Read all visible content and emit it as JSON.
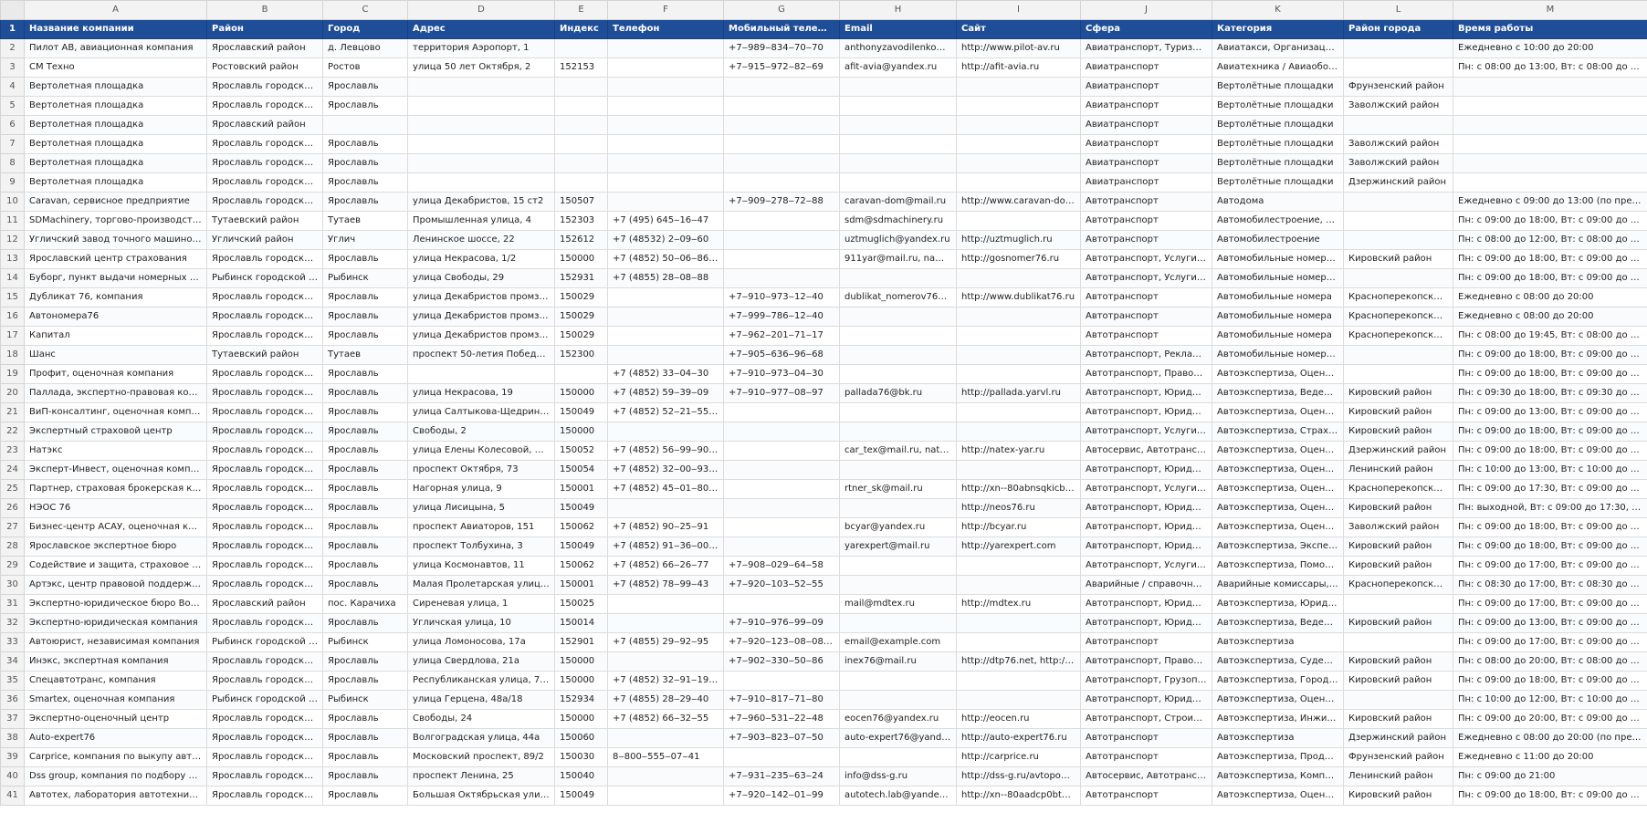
{
  "columns": [
    "A",
    "B",
    "C",
    "D",
    "E",
    "F",
    "G",
    "H",
    "I",
    "J",
    "K",
    "L",
    "M"
  ],
  "header": {
    "row_num": "1",
    "cells": [
      "Название компании",
      "Район",
      "Город",
      "Адрес",
      "Индекс",
      "Телефон",
      "Мобильный телефон",
      "Email",
      "Сайт",
      "Сфера",
      "Категория",
      "Район города",
      "Время работы"
    ]
  },
  "rows": [
    {
      "n": "2",
      "c": [
        "Пилот АВ, авиационная компания",
        "Ярославский район",
        "д. Левцово",
        "территория Аэропорт, 1",
        "",
        "",
        "+7‒989‒834‒70‒70",
        "anthonyzavodilenko@y...",
        "http://www.pilot-av.ru",
        "Авиатранспорт, Туризм / ...",
        "Авиатакси, Организация а...",
        "",
        "Ежедневно с 10:00 до 20:00"
      ]
    },
    {
      "n": "3",
      "c": [
        "СМ Техно",
        "Ростовский район",
        "Ростов",
        "улица 50 лет Октября, 2",
        "152153",
        "",
        "+7‒915‒972‒82‒69",
        "afit-avia@yandex.ru",
        "http://afit-avia.ru",
        "Авиатранспорт",
        "Авиатехника / Авиаобору...",
        "",
        "Пн: с 08:00 до 13:00, Вт: с 08:00 до 13:00, С..."
      ]
    },
    {
      "n": "4",
      "c": [
        "Вертолетная площадка",
        "Ярославль городской ...",
        "Ярославль",
        "",
        "",
        "",
        "",
        "",
        "",
        "Авиатранспорт",
        "Вертолётные площадки",
        "Фрунзенский район",
        ""
      ]
    },
    {
      "n": "5",
      "c": [
        "Вертолетная площадка",
        "Ярославль городской ...",
        "Ярославль",
        "",
        "",
        "",
        "",
        "",
        "",
        "Авиатранспорт",
        "Вертолётные площадки",
        "Заволжский район",
        ""
      ]
    },
    {
      "n": "6",
      "c": [
        "Вертолетная площадка",
        "Ярославский район",
        "",
        "",
        "",
        "",
        "",
        "",
        "",
        "Авиатранспорт",
        "Вертолётные площадки",
        "",
        ""
      ]
    },
    {
      "n": "7",
      "c": [
        "Вертолетная площадка",
        "Ярославль городской ...",
        "Ярославль",
        "",
        "",
        "",
        "",
        "",
        "",
        "Авиатранспорт",
        "Вертолётные площадки",
        "Заволжский район",
        ""
      ]
    },
    {
      "n": "8",
      "c": [
        "Вертолетная площадка",
        "Ярославль городской ...",
        "Ярославль",
        "",
        "",
        "",
        "",
        "",
        "",
        "Авиатранспорт",
        "Вертолётные площадки",
        "Заволжский район",
        ""
      ]
    },
    {
      "n": "9",
      "c": [
        "Вертолетная площадка",
        "Ярославль городской ...",
        "Ярославль",
        "",
        "",
        "",
        "",
        "",
        "",
        "Авиатранспорт",
        "Вертолётные площадки",
        "Дзержинский район",
        ""
      ]
    },
    {
      "n": "10",
      "c": [
        "Caravan, сервисное предприятие",
        "Ярославль городской ...",
        "Ярославль",
        "улица Декабристов, 15 ст2",
        "150507",
        "",
        "+7‒909‒278‒72‒88",
        "caravan-dom@mail.ru",
        "http://www.caravan-dom.ru",
        "Автотранспорт",
        "Автодома",
        "",
        "Ежедневно с 09:00 до 13:00 (по предвари..."
      ]
    },
    {
      "n": "11",
      "c": [
        "SDMachinery, торгово-производствен...",
        "Тутаевский район",
        "Тутаев",
        "Промышленная улица, 4",
        "152303",
        "+7 (495) 645‒16‒47",
        "",
        "sdm@sdmachinery.ru",
        "",
        "Автотранспорт",
        "Автомобилестроение, Спе...",
        "",
        "Пн: с 09:00 до 18:00, Вт: с 09:00 до 18:00, С..."
      ]
    },
    {
      "n": "12",
      "c": [
        "Угличский завод точного машиностр...",
        "Угличский район",
        "Углич",
        "Ленинское шоссе, 22",
        "152612",
        "+7 (48532) 2‒09‒60",
        "",
        "uztmuglich@yandex.ru",
        "http://uztmuglich.ru",
        "Автотранспорт",
        "Автомобилестроение",
        "",
        "Пн: с 08:00 до 12:00, Вт: с 08:00 до 12:00, С..."
      ]
    },
    {
      "n": "13",
      "c": [
        "Ярославский центр страхования",
        "Ярославль городской ...",
        "Ярославль",
        "улица Некрасова, 1/2",
        "150000",
        "+7 (4852) 50‒06‒86, +7...",
        "",
        "911yar@mail.ru, name...",
        "http://gosnomer76.ru",
        "Автотранспорт, Услуги стр...",
        "Автомобильные номера, ...",
        "Кировский район",
        "Пн: с 09:00 до 18:00, Вт: с 09:00 до 18:00, С..."
      ]
    },
    {
      "n": "14",
      "c": [
        "Буборг, пункт выдачи номерных знак...",
        "Рыбинск городской ок...",
        "Рыбинск",
        "улица Свободы, 29",
        "152931",
        "+7 (4855) 28‒08‒88",
        "",
        "",
        "",
        "Автотранспорт, Услуги стр...",
        "Автомобильные номера, С...",
        "",
        "Пн: с 09:00 до 18:00, Вт: с 09:00 до 18:00, С..."
      ]
    },
    {
      "n": "15",
      "c": [
        "Дубликат 76, компания",
        "Ярославль городской ...",
        "Ярославль",
        "улица Декабристов промзона,...",
        "150029",
        "",
        "+7‒910‒973‒12‒40",
        "dublikat_nomerov76@...",
        "http://www.dublikat76.ru",
        "Автотранспорт",
        "Автомобильные номера",
        "Красноперекопский ...",
        "Ежедневно с 08:00 до 20:00"
      ]
    },
    {
      "n": "16",
      "c": [
        "Автономера76",
        "Ярославль городской ...",
        "Ярославль",
        "улица Декабристов промзона,...",
        "150029",
        "",
        "+7‒999‒786‒12‒40",
        "",
        "",
        "Автотранспорт",
        "Автомобильные номера",
        "Красноперекопский ...",
        "Ежедневно с 08:00 до 20:00"
      ]
    },
    {
      "n": "17",
      "c": [
        "Капитал",
        "Ярославль городской ...",
        "Ярославль",
        "улица Декабристов промзона,...",
        "150029",
        "",
        "+7‒962‒201‒71‒17",
        "",
        "",
        "Автотранспорт",
        "Автомобильные номера",
        "Красноперекопский ...",
        "Пн: с 08:00 до 19:45, Вт: с 08:00 до 19:45, С..."
      ]
    },
    {
      "n": "18",
      "c": [
        "Шанс",
        "Тутаевский район",
        "Тутаев",
        "проспект 50-летия Победы, 27а",
        "152300",
        "",
        "+7‒905‒636‒96‒68",
        "",
        "",
        "Автотранспорт, Рекламны...",
        "Автомобильные номера, В...",
        "",
        "Пн: с 09:00 до 18:00, Вт: с 09:00 до 18:00, С..."
      ]
    },
    {
      "n": "19",
      "c": [
        "Профит, оценочная компания",
        "Ярославль городской ...",
        "Ярославль",
        "",
        "",
        "+7 (4852) 33‒04‒30",
        "+7‒910‒973‒04‒30",
        "",
        "",
        "Автотранспорт, Правоохр...",
        "Автоэкспертиза, Оценка с...",
        "",
        "Пн: с 09:00 до 18:00, Вт: с 09:00 до 18:00, С..."
      ]
    },
    {
      "n": "20",
      "c": [
        "Паллада, экспертно-правовая компан...",
        "Ярославль городской ...",
        "Ярославль",
        "улица Некрасова, 19",
        "150000",
        "+7 (4852) 59‒39‒09",
        "+7‒910‒977‒08‒97",
        "pallada76@bk.ru",
        "http://pallada.yarvl.ru",
        "Автотранспорт, Юридичес...",
        "Автоэкспертиза, Ведение ...",
        "Кировский район",
        "Пн: с 09:30 до 18:00, Вт: с 09:30 до 18:00, С..."
      ]
    },
    {
      "n": "21",
      "c": [
        "ВиП-консалтинг, оценочная компания",
        "Ярославль городской ...",
        "Ярославль",
        "улица Салтыкова-Щедрина, 111",
        "150049",
        "+7 (4852) 52‒21‒55, +7...",
        "",
        "",
        "",
        "Автотранспорт, Юридичес...",
        "Автоэкспертиза, Оценка с...",
        "Кировский район",
        "Пн: с 09:00 до 13:00, Вт: с 09:00 до 13:00, С..."
      ]
    },
    {
      "n": "22",
      "c": [
        "Экспертный страховой центр",
        "Ярославль городской ...",
        "Ярославль",
        "Свободы, 2",
        "150000",
        "",
        "",
        "",
        "",
        "Автотранспорт, Услуги стр...",
        "Автоэкспертиза, Страхова...",
        "Кировский район",
        "Пн: с 09:00 до 18:00, Вт: с 09:00 до 18:00, С..."
      ]
    },
    {
      "n": "23",
      "c": [
        "Натэкс",
        "Ярославль городской ...",
        "Ярославль",
        "улица Елены Колесовой, 15а",
        "150052",
        "+7 (4852) 56‒99‒90, +7...",
        "",
        "car_tex@mail.ru, natex-t...",
        "http://natex-yar.ru",
        "Автосервис, Автотранспор...",
        "Автоэкспертиза, Оценка с...",
        "Дзержинский район",
        "Пн: с 09:00 до 18:00, Вт: с 09:00 до 18:00, С..."
      ]
    },
    {
      "n": "24",
      "c": [
        "Эксперт-Инвест, оценочная компания",
        "Ярославль городской ...",
        "Ярославль",
        "проспект Октября, 73",
        "150054",
        "+7 (4852) 32‒00‒93, +7...",
        "",
        "",
        "",
        "Автотранспорт, Юридичес...",
        "Автоэкспертиза, Оценка с...",
        "Ленинский район",
        "Пн: с 10:00 до 13:00, Вт: с 10:00 до 13:00, С..."
      ]
    },
    {
      "n": "25",
      "c": [
        "Партнер, страховая брокерская комп...",
        "Ярославль городской ...",
        "Ярославль",
        "Нагорная улица, 9",
        "150001",
        "+7 (4852) 45‒01‒80, +7...",
        "",
        "rtner_sk@mail.ru",
        "http://xn--80abnsqkicbp.x...",
        "Автотранспорт, Услуги стр...",
        "Автоэкспертиза, Оценка с...",
        "Красноперекопский ...",
        "Пн: с 09:00 до 17:30, Вт: с 09:00 до 17:30, С..."
      ]
    },
    {
      "n": "26",
      "c": [
        "НЭОС 76",
        "Ярославль городской ...",
        "Ярославль",
        "улица Лисицына, 5",
        "150049",
        "",
        "",
        "",
        "http://neos76.ru",
        "Автотранспорт, Юридичес...",
        "Автоэкспертиза, Оценка с...",
        "Кировский район",
        "Пн: выходной, Вт: с 09:00 до 17:30, Ср: с 0..."
      ]
    },
    {
      "n": "27",
      "c": [
        "Бизнес-центр АСАУ, оценочная комп...",
        "Ярославль городской ...",
        "Ярославль",
        "проспект Авиаторов, 151",
        "150062",
        "+7 (4852) 90‒25‒91",
        "",
        "bcyar@yandex.ru",
        "http://bcyar.ru",
        "Автотранспорт, Юридичес...",
        "Автоэкспертиза, Оценка с...",
        "Заволжский район",
        "Пн: с 09:00 до 18:00, Вт: с 09:00 до 18:00, С..."
      ]
    },
    {
      "n": "28",
      "c": [
        "Ярославское экспертное бюро",
        "Ярославль городской ...",
        "Ярославль",
        "проспект Толбухина, 3",
        "150049",
        "+7 (4852) 91‒36‒00, +7...",
        "",
        "yarexpert@mail.ru",
        "http://yarexpert.com",
        "Автотранспорт, Юридичес...",
        "Автоэкспертиза, Эксперти...",
        "Кировский район",
        "Пн: с 09:00 до 18:00, Вт: с 09:00 до 18:00, С..."
      ]
    },
    {
      "n": "29",
      "c": [
        "Содействие и защита, страховое аген...",
        "Ярославль городской ...",
        "Ярославль",
        "улица Космонавтов, 11",
        "150062",
        "+7 (4852) 66‒26‒77",
        "+7‒908‒029‒64‒58",
        "",
        "",
        "Автотранспорт, Услуги стр...",
        "Автоэкспертиза, Помощь ...",
        "Кировский район",
        "Пн: с 09:00 до 17:00, Вт: с 09:00 до 17:00, С..."
      ]
    },
    {
      "n": "30",
      "c": [
        "Артэкс, центр правовой поддержки и...",
        "Ярославль городской ...",
        "Ярославль",
        "Малая Пролетарская улица, 18а",
        "150001",
        "+7 (4852) 78‒99‒43",
        "+7‒920‒103‒52‒55",
        "",
        "",
        "Аварийные / справочные ...",
        "Аварийные комиссары, Ав...",
        "Красноперекопский ...",
        "Пн: с 08:30 до 17:00, Вт: с 08:30 до 17:00, С..."
      ]
    },
    {
      "n": "31",
      "c": [
        "Экспертно-юридическое бюро Воро...",
        "Ярославский район",
        "пос. Карачиха",
        "Сиреневая улица, 1",
        "150025",
        "",
        "",
        "mail@mdtex.ru",
        "http://mdtex.ru",
        "Автотранспорт, Юридичес...",
        "Автоэкспертиза, Юридиче...",
        "",
        "Пн: с 09:00 до 17:00, Вт: с 09:00 до 17:00, С..."
      ]
    },
    {
      "n": "32",
      "c": [
        "Экспертно-юридическая компания",
        "Ярославль городской ...",
        "Ярославль",
        "Угличская улица, 10",
        "150014",
        "",
        "+7‒910‒976‒99‒09",
        "",
        "",
        "Автотранспорт, Юридичес...",
        "Автоэкспертиза, Ведение ...",
        "Кировский район",
        "Пн: с 09:00 до 13:00, Вт: с 09:00 до 13:00, С..."
      ]
    },
    {
      "n": "33",
      "c": [
        "Автоюрист, независимая компания",
        "Рыбинск городской ок...",
        "Рыбинск",
        "улица Ломоносова, 17а",
        "152901",
        "+7 (4855) 29‒92‒95",
        "+7‒920‒123‒08‒08, +7...",
        "email@example.com",
        "",
        "Автотранспорт",
        "Автоэкспертиза",
        "",
        "Пн: с 09:00 до 17:00, Вт: с 09:00 до 17:00, С..."
      ]
    },
    {
      "n": "34",
      "c": [
        "Инэкс, экспертная компания",
        "Ярославль городской ...",
        "Ярославль",
        "улица Свердлова, 21а",
        "150000",
        "",
        "+7‒902‒330‒50‒86",
        "inex76@mail.ru",
        "http://dtp76.net, http://m...",
        "Автотранспорт, Правоохр...",
        "Автоэкспертиза, Судебная ...",
        "Кировский район",
        "Пн: с 08:00 до 20:00, Вт: с 08:00 до 20:00, С..."
      ]
    },
    {
      "n": "35",
      "c": [
        "Спецавтотранс, компания",
        "Ярославль городской ...",
        "Ярославль",
        "Республиканская улица, 75Б",
        "150000",
        "+7 (4852) 32‒91‒19, +7...",
        "",
        "",
        "",
        "Автотранспорт, Грузопере...",
        "Автоэкспертиза, Городски...",
        "Кировский район",
        "Пн: с 09:00 до 18:00, Вт: с 09:00 до 18:00, С..."
      ]
    },
    {
      "n": "36",
      "c": [
        "Smartex, оценочная компания",
        "Рыбинск городской ок...",
        "Рыбинск",
        "улица Герцена, 48а/18",
        "152934",
        "+7 (4855) 28‒29‒40",
        "+7‒910‒817‒71‒80",
        "",
        "",
        "Автотранспорт, Юридичес...",
        "Автоэкспертиза, Оценка с...",
        "",
        "Пн: с 10:00 до 12:00, Вт: с 10:00 до 12:00, С..."
      ]
    },
    {
      "n": "37",
      "c": [
        "Экспертно-оценочный центр",
        "Ярославль городской ...",
        "Ярославль",
        "Свободы, 24",
        "150000",
        "+7 (4852) 66‒32‒55",
        "+7‒960‒531‒22‒48",
        "eocen76@yandex.ru",
        "http://eocen.ru",
        "Автотранспорт, Строитель...",
        "Автоэкспертиза, Инжинир...",
        "Кировский район",
        "Пн: с 09:00 до 20:00, Вт: с 09:00 до 20:00, С..."
      ]
    },
    {
      "n": "38",
      "c": [
        "Auto-expert76",
        "Ярославль городской ...",
        "Ярославль",
        "Волгоградская улица, 44а",
        "150060",
        "",
        "+7‒903‒823‒07‒50",
        "auto-expert76@yandex...",
        "http://auto-expert76.ru",
        "Автотранспорт",
        "Автоэкспертиза",
        "Дзержинский район",
        "Ежедневно с 08:00 до 20:00 (по предвари..."
      ]
    },
    {
      "n": "39",
      "c": [
        "Carprice, компания по выкупу автомо...",
        "Ярославль городской ...",
        "Ярославль",
        "Московский проспект, 89/2",
        "150030",
        "8‒800‒555‒07‒41",
        "",
        "",
        "http://carprice.ru",
        "Автотранспорт",
        "Автоэкспертиза, Продажа ...",
        "Фрунзенский район",
        "Ежедневно с 11:00 до 20:00"
      ]
    },
    {
      "n": "40",
      "c": [
        "Dss group, компания по подбору авт...",
        "Ярославль городской ...",
        "Ярославль",
        "проспект Ленина, 25",
        "150040",
        "",
        "+7‒931‒235‒63‒24",
        "info@dss-g.ru",
        "http://dss-g.ru/avtopodb...",
        "Автосервис, Автотранспорт",
        "Автоэкспертиза, Компьют...",
        "Ленинский район",
        "Пн: с 09:00 до 21:00"
      ]
    },
    {
      "n": "41",
      "c": [
        "Автотех, лаборатория автотехническ...",
        "Ярославль городской ...",
        "Ярославль",
        "Большая Октябрьская улица, 87",
        "150049",
        "",
        "+7‒920‒142‒01‒99",
        "autotech.lab@yandex.ru",
        "http://xn--80aadcp0bt5ab...",
        "Автотранспорт",
        "Автоэкспертиза, Оценка с...",
        "Кировский район",
        "Пн: с 09:00 до 18:00, Вт: с 09:00 до 18:00, С..."
      ]
    }
  ]
}
